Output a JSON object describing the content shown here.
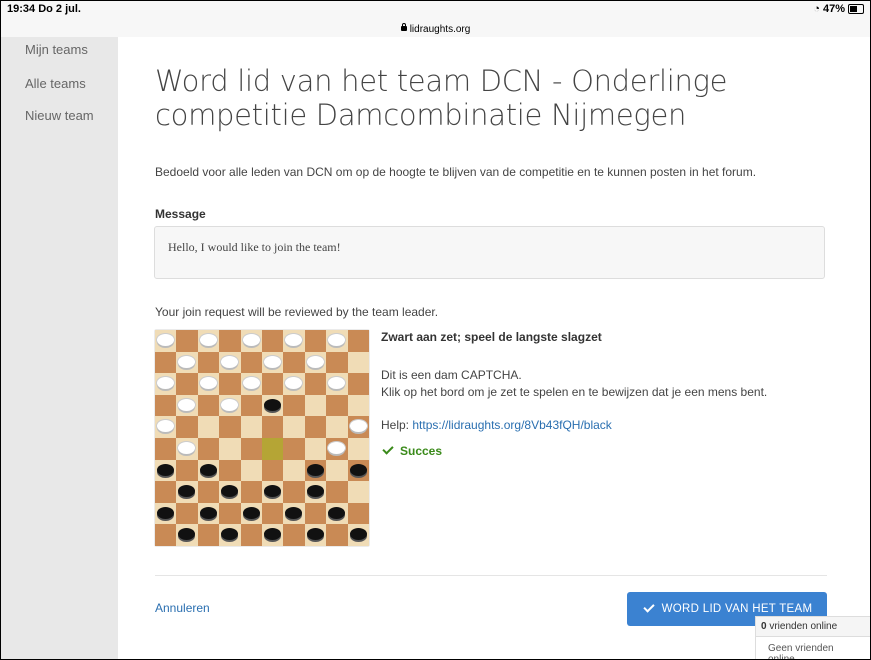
{
  "status_bar": {
    "time": "19:34  Do 2 jul.",
    "url": "lidraughts.org",
    "battery": "47%"
  },
  "sidebar": {
    "items": [
      {
        "label": "Mijn teams"
      },
      {
        "label": "Alle teams"
      },
      {
        "label": "Nieuw team"
      }
    ]
  },
  "page": {
    "title_line1": "Word lid van het team DCN - Onderlinge",
    "title_line2": "competitie Damcombinatie Nijmegen",
    "description": "Bedoeld voor alle leden van DCN om op de hoogte te blijven van de competitie en te kunnen posten in het forum.",
    "message_label": "Message",
    "message_value": "Hello, I would like to join the team!",
    "review_note": "Your join request will be reviewed by the team leader."
  },
  "captcha": {
    "title": "Zwart aan zet; speel de langste slagzet",
    "line1": "Dit is een dam CAPTCHA.",
    "line2": "Klik op het bord om je zet te spelen en te bewijzen dat je een mens bent.",
    "help_label": "Help:",
    "help_link": "https://lidraughts.org/8Vb43fQH/black",
    "status": "Succes",
    "board": [
      "W.W.W.W.W.",
      ".W.W.W.W..",
      "W.W.W.W.W.",
      ".W.W.B....",
      "W........W",
      ".W...H..W.",
      "B.B....B.B",
      ".B.B.B.B..",
      "B.B.B.B.B.",
      ".B.B.B.B.B"
    ]
  },
  "actions": {
    "cancel_label": "Annuleren",
    "join_label": "WORD LID VAN HET TEAM"
  },
  "friends": {
    "count": "0",
    "online_label": "vrienden online",
    "none_label": "Geen vrienden online"
  }
}
